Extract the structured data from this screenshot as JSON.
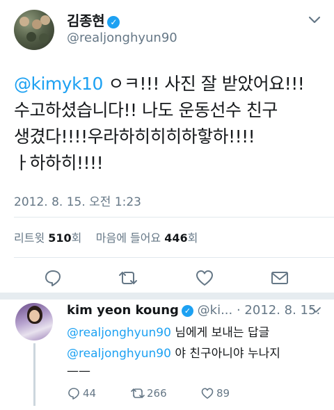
{
  "tweet": {
    "display_name": "김종현",
    "handle": "@realjonghyun90",
    "mention": "@kimyk10",
    "lines": [
      " ㅇㅋ!!! 사진 잘 받았어요!!!",
      "수고하셨습니다!! 나도 운동선수 친구",
      "생겼다!!!!우라하히히히하핳하!!!!",
      "ㅏ하하히!!!!"
    ],
    "timestamp": "2012. 8. 15. 오전 1:23",
    "retweet_label": "리트윗",
    "retweet_count": "510",
    "count_suffix": "회",
    "like_label": "마음에 들어요",
    "like_count": "446"
  },
  "reply": {
    "display_name": "kim yeon koung",
    "meta": "@ki... · 2012. 8. 15.",
    "replying_to_handle": "@realjonghyun90",
    "replying_to_suffix": " 님에게 보내는 답글",
    "text_mention": "@realjonghyun90",
    "text": " 야 친구아니야 누나지",
    "text_tail": "——",
    "reply_count": "44",
    "retweet_count": "266",
    "like_count": "89"
  },
  "colors": {
    "accent": "#1da1f2",
    "secondary_text": "#657786",
    "separator": "#e6ecf0"
  },
  "icons": {
    "verified": "verified-badge-icon",
    "chevron": "chevron-down-icon",
    "reply": "reply-icon",
    "retweet": "retweet-icon",
    "like": "heart-icon",
    "share": "share-mail-icon"
  }
}
